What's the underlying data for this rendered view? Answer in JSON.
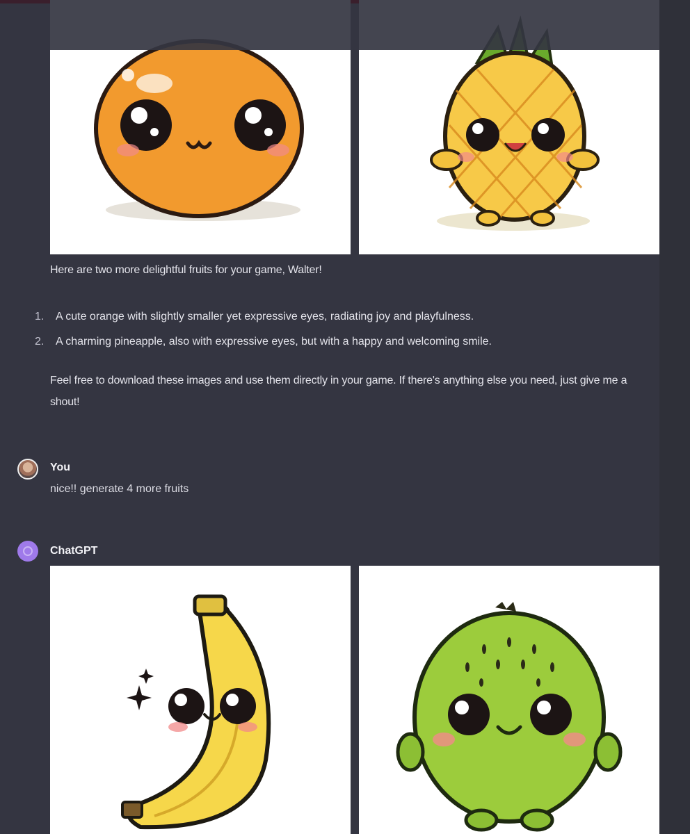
{
  "conversation": {
    "previous_reply": {
      "images": [
        {
          "subject": "cute orange"
        },
        {
          "subject": "cute pineapple"
        }
      ],
      "intro": "Here are two more delightful fruits for your game, Walter!",
      "list": [
        {
          "num": "1.",
          "text": "A cute orange with slightly smaller yet expressive eyes, radiating joy and playfulness."
        },
        {
          "num": "2.",
          "text": "A charming pineapple, also with expressive eyes, but with a happy and welcoming smile."
        }
      ],
      "outro": "Feel free to download these images and use them directly in your game. If there's anything else you need, just give me a shout!"
    },
    "user_message": {
      "sender": "You",
      "text": "nice!! generate 4 more fruits"
    },
    "assistant_reply": {
      "sender": "ChatGPT",
      "images": [
        {
          "subject": "cute banana"
        },
        {
          "subject": "cute kiwi"
        }
      ]
    }
  },
  "colors": {
    "background": "#343541",
    "orange": "#f29a2e",
    "pineapple": "#f7c948",
    "banana": "#f6d74a",
    "kiwi": "#9ccc3c",
    "assistant_avatar": "#9f7aea"
  }
}
